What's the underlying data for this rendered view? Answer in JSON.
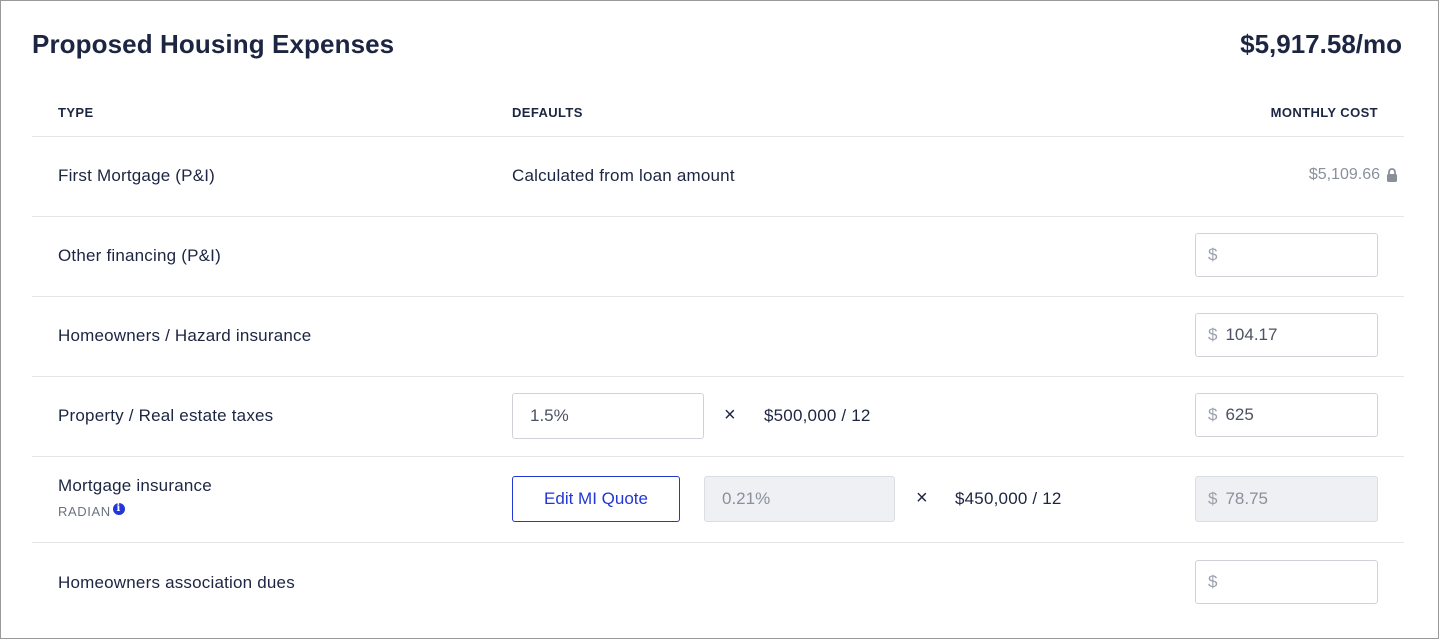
{
  "section": {
    "title": "Proposed Housing Expenses",
    "total": "$5,917.58/mo"
  },
  "columns": {
    "type": "TYPE",
    "defaults": "DEFAULTS",
    "monthly_cost": "MONTHLY COST"
  },
  "currency_symbol": "$",
  "times_symbol": "×",
  "rows": {
    "first_mortgage": {
      "label": "First Mortgage (P&I)",
      "default_text": "Calculated from loan amount",
      "cost": "$5,109.66",
      "cost_icon": "lock-icon"
    },
    "other_financing": {
      "label": "Other financing (P&I)",
      "cost_value": ""
    },
    "hazard_insurance": {
      "label": "Homeowners / Hazard insurance",
      "cost_value": "104.17"
    },
    "property_taxes": {
      "label": "Property / Real estate taxes",
      "rate": "1.5%",
      "basis": "$500,000 / 12",
      "cost_value": "625"
    },
    "mortgage_insurance": {
      "label": "Mortgage insurance",
      "provider": "RADIAN",
      "provider_icon": "info-icon",
      "button_label": "Edit MI Quote",
      "rate": "0.21%",
      "basis": "$450,000 / 12",
      "cost_value": "78.75"
    },
    "hoa_dues": {
      "label": "Homeowners association dues",
      "cost_value": ""
    }
  },
  "colors": {
    "text": "#1c2541",
    "accent": "#2336d6",
    "muted": "#8a8f9c",
    "disabled_bg": "#eef0f3"
  }
}
